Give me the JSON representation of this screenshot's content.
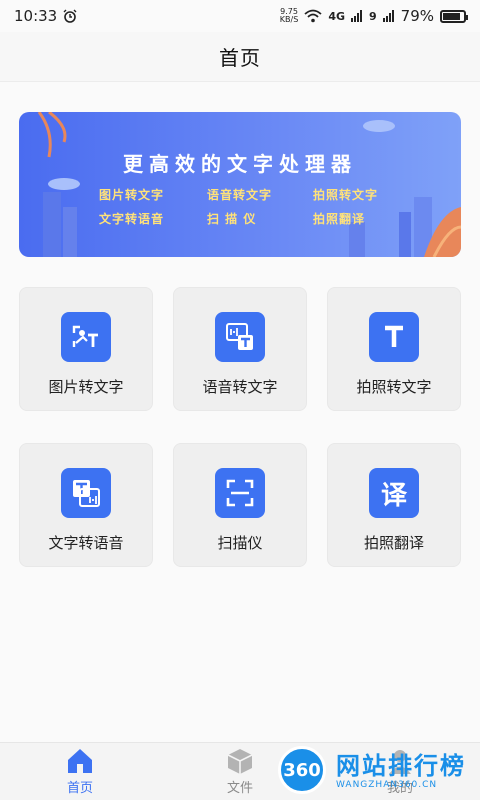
{
  "status_bar": {
    "time": "10:33",
    "net_speed_value": "9.75",
    "net_speed_unit": "KB/S",
    "signal_1": "4G",
    "signal_2": "9",
    "battery": "79%",
    "battery_level": 0.79
  },
  "header": {
    "title": "首页"
  },
  "banner": {
    "headline": "更高效的文字处理器",
    "features": [
      "图片转文字",
      "语音转文字",
      "拍照转文字",
      "文字转语音",
      "扫 描 仪",
      "拍照翻译"
    ]
  },
  "tools": [
    {
      "label": "图片转文字",
      "icon": "image-to-text-icon"
    },
    {
      "label": "语音转文字",
      "icon": "voice-to-text-icon"
    },
    {
      "label": "拍照转文字",
      "icon": "photo-to-text-icon"
    },
    {
      "label": "文字转语音",
      "icon": "text-to-speech-icon"
    },
    {
      "label": "扫描仪",
      "icon": "scanner-icon"
    },
    {
      "label": "拍照翻译",
      "icon": "translate-icon"
    }
  ],
  "translate_glyph": "译",
  "text_glyph": "T",
  "bottom_nav": {
    "items": [
      {
        "label": "首页",
        "icon": "home-icon",
        "active": true
      },
      {
        "label": "文件",
        "icon": "box-icon",
        "active": false
      },
      {
        "label": "我的",
        "icon": "user-icon",
        "active": false
      }
    ]
  },
  "watermark": {
    "badge": "360",
    "text": "网站排行榜",
    "sub": "WANGZHAN360.CN"
  },
  "colors": {
    "accent": "#3d72f2",
    "banner": "#4a6cf0",
    "feature_text": "#ffe27a"
  }
}
